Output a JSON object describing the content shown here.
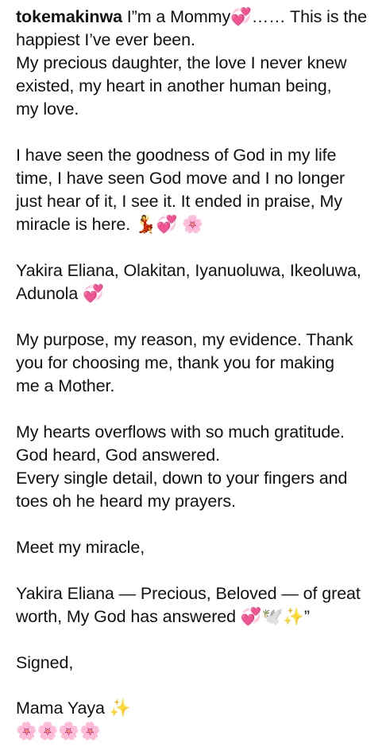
{
  "post": {
    "username": "tokemakinwa",
    "paragraphs": [
      {
        "first_line_rest": " I”m a Mommy💞…… This is the",
        "lines": [
          "happiest I’ve ever been.",
          "My precious daughter, the love I never knew",
          "existed, my heart in another human being,",
          "my love."
        ]
      },
      {
        "lines": [
          "I have seen the  goodness of God in my life",
          "time, I have seen God move and I no longer",
          "just hear of  it, I see it. It ended in praise, My",
          "miracle is here. 💃💞 🌸"
        ]
      },
      {
        "lines": [
          "Yakira Eliana, Olakitan, Iyanuoluwa, Ikeoluwa,",
          "Adunola 💞"
        ]
      },
      {
        "lines": [
          "My purpose, my reason, my evidence. Thank",
          "you for choosing me, thank you for making",
          "me a Mother."
        ]
      },
      {
        "lines": [
          "My hearts overflows with so much gratitude.",
          "God heard, God answered.",
          "Every single detail, down to your fingers and",
          "toes oh he heard my prayers."
        ]
      },
      {
        "lines": [
          "Meet my miracle,"
        ]
      },
      {
        "lines": [
          "Yakira Eliana — Precious, Beloved — of great",
          "worth, My God has answered 💞🕊️✨”"
        ]
      },
      {
        "lines": [
          "Signed,"
        ]
      },
      {
        "lines": [
          "Mama Yaya ✨",
          "🌸🌸🌸🌸"
        ]
      }
    ]
  }
}
